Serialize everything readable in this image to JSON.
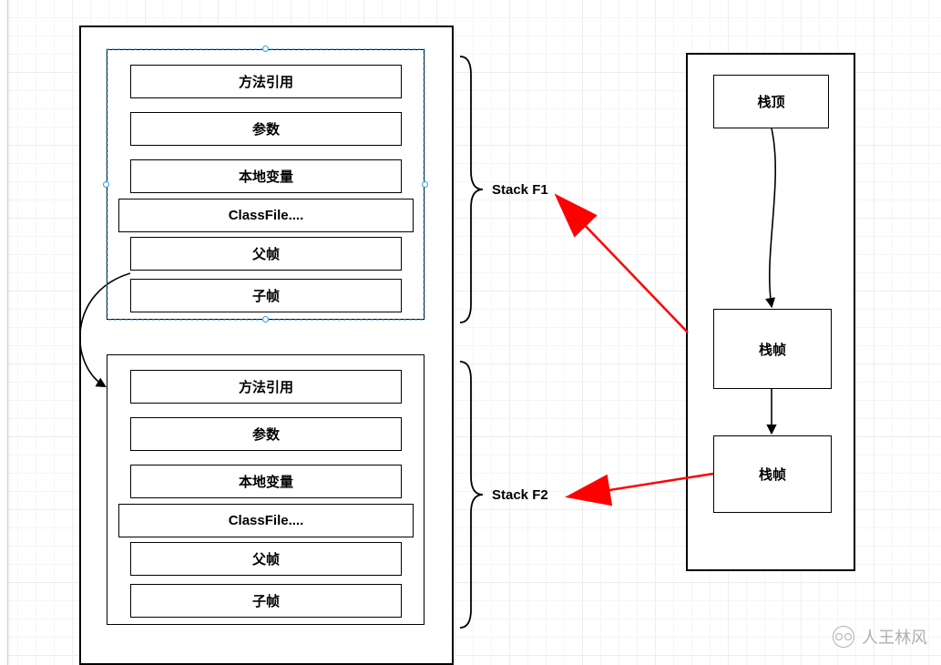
{
  "frames": {
    "f1": {
      "label": "Stack F1",
      "cells": [
        "方法引用",
        "参数",
        "本地变量",
        "ClassFile....",
        "父帧",
        "子帧"
      ]
    },
    "f2": {
      "label": "Stack F2",
      "cells": [
        "方法引用",
        "参数",
        "本地变量",
        "ClassFile....",
        "父帧",
        "子帧"
      ]
    }
  },
  "right_stack": {
    "nodes": [
      "栈顶",
      "栈帧",
      "栈帧"
    ]
  },
  "watermark": "人王林风"
}
